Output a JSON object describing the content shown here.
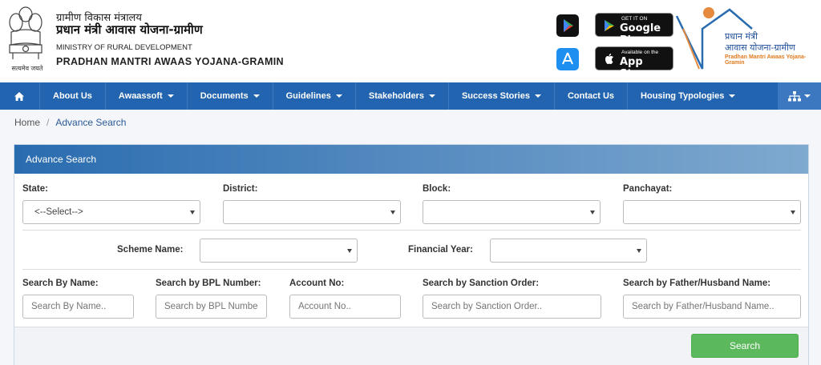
{
  "header": {
    "hindi_ministry": "ग्रामीण विकास मंत्रालय",
    "hindi_scheme": "प्रधान मंत्री आवास योजना-ग्रामीण",
    "ministry": "MINISTRY OF RURAL DEVELOPMENT",
    "scheme": "PRADHAN MANTRI AWAAS YOJANA-GRAMIN",
    "emblem_motto": "सत्यमेव जयते",
    "google_play_small": "GET IT ON",
    "google_play_big": "Google Play",
    "app_store_small": "Available on the",
    "app_store_big": "App Store",
    "logo_line1": "प्रधान मंत्री",
    "logo_line2": "आवास योजना-ग्रामीण",
    "logo_line3": "Pradhan Mantri Awaas Yojana-Gramin"
  },
  "nav": {
    "items": [
      {
        "label": "About Us",
        "dropdown": false
      },
      {
        "label": "Awaassoft",
        "dropdown": true
      },
      {
        "label": "Documents",
        "dropdown": true
      },
      {
        "label": "Guidelines",
        "dropdown": true
      },
      {
        "label": "Stakeholders",
        "dropdown": true
      },
      {
        "label": "Success Stories",
        "dropdown": true
      },
      {
        "label": "Contact Us",
        "dropdown": false
      },
      {
        "label": "Housing Typologies",
        "dropdown": true
      }
    ]
  },
  "breadcrumb": {
    "home": "Home",
    "separator": "/",
    "current": "Advance Search"
  },
  "panel": {
    "title": "Advance Search",
    "state_label": "State:",
    "state_value": "<--Select-->",
    "district_label": "District:",
    "district_value": "",
    "block_label": "Block:",
    "block_value": "",
    "panchayat_label": "Panchayat:",
    "panchayat_value": "",
    "scheme_label": "Scheme Name:",
    "scheme_value": "",
    "fy_label": "Financial Year:",
    "fy_value": "",
    "name_label": "Search By Name:",
    "name_placeholder": "Search By Name..",
    "bpl_label": "Search by BPL Number:",
    "bpl_placeholder": "Search by BPL Number..",
    "account_label": "Account No:",
    "account_placeholder": "Account No..",
    "sanction_label": "Search by Sanction Order:",
    "sanction_placeholder": "Search by Sanction Order..",
    "father_label": "Search by Father/Husband Name:",
    "father_placeholder": "Search by Father/Husband Name..",
    "search_button": "Search"
  },
  "colors": {
    "nav_bg": "#2364b0",
    "panel_head": "#2a6cb0",
    "search_btn": "#5cb85c"
  }
}
